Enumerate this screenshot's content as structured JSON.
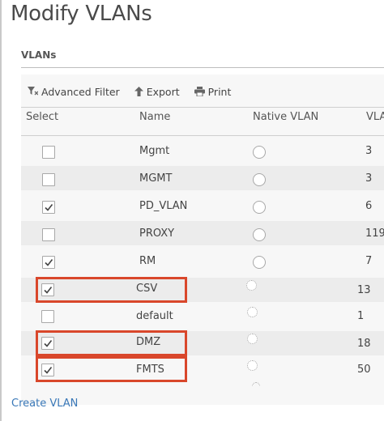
{
  "page": {
    "title": "Modify VLANs",
    "section_label": "VLANs"
  },
  "toolbar": {
    "advanced_filter": "Advanced Filter",
    "export": "Export",
    "print": "Print"
  },
  "table": {
    "headers": {
      "select": "Select",
      "name": "Name",
      "native_vlan": "Native VLAN",
      "vlan_id": "VLA"
    },
    "rows": [
      {
        "checked": false,
        "name": "Mgmt",
        "native": false,
        "id": "3",
        "highlighted": false
      },
      {
        "checked": false,
        "name": "MGMT",
        "native": false,
        "id": "3",
        "highlighted": false
      },
      {
        "checked": true,
        "name": "PD_VLAN",
        "native": false,
        "id": "6",
        "highlighted": false
      },
      {
        "checked": false,
        "name": "PROXY",
        "native": false,
        "id": "119",
        "highlighted": false
      },
      {
        "checked": true,
        "name": "RM",
        "native": false,
        "id": "7",
        "highlighted": false
      },
      {
        "checked": true,
        "name": "CSV",
        "native": false,
        "id": "13",
        "highlighted": true
      },
      {
        "checked": false,
        "name": "default",
        "native": false,
        "id": "1",
        "highlighted": false
      },
      {
        "checked": true,
        "name": "DMZ",
        "native": false,
        "id": "18",
        "highlighted": true
      },
      {
        "checked": true,
        "name": "FMTS",
        "native": false,
        "id": "50",
        "highlighted": true
      }
    ]
  },
  "footer": {
    "create_vlan": "Create VLAN"
  },
  "colors": {
    "highlight": "#d9472b",
    "link": "#3a78b8",
    "stripe": "#ececec"
  },
  "icons": {
    "advanced_filter": "filter-icon",
    "export": "arrow-up-icon",
    "print": "printer-icon"
  }
}
